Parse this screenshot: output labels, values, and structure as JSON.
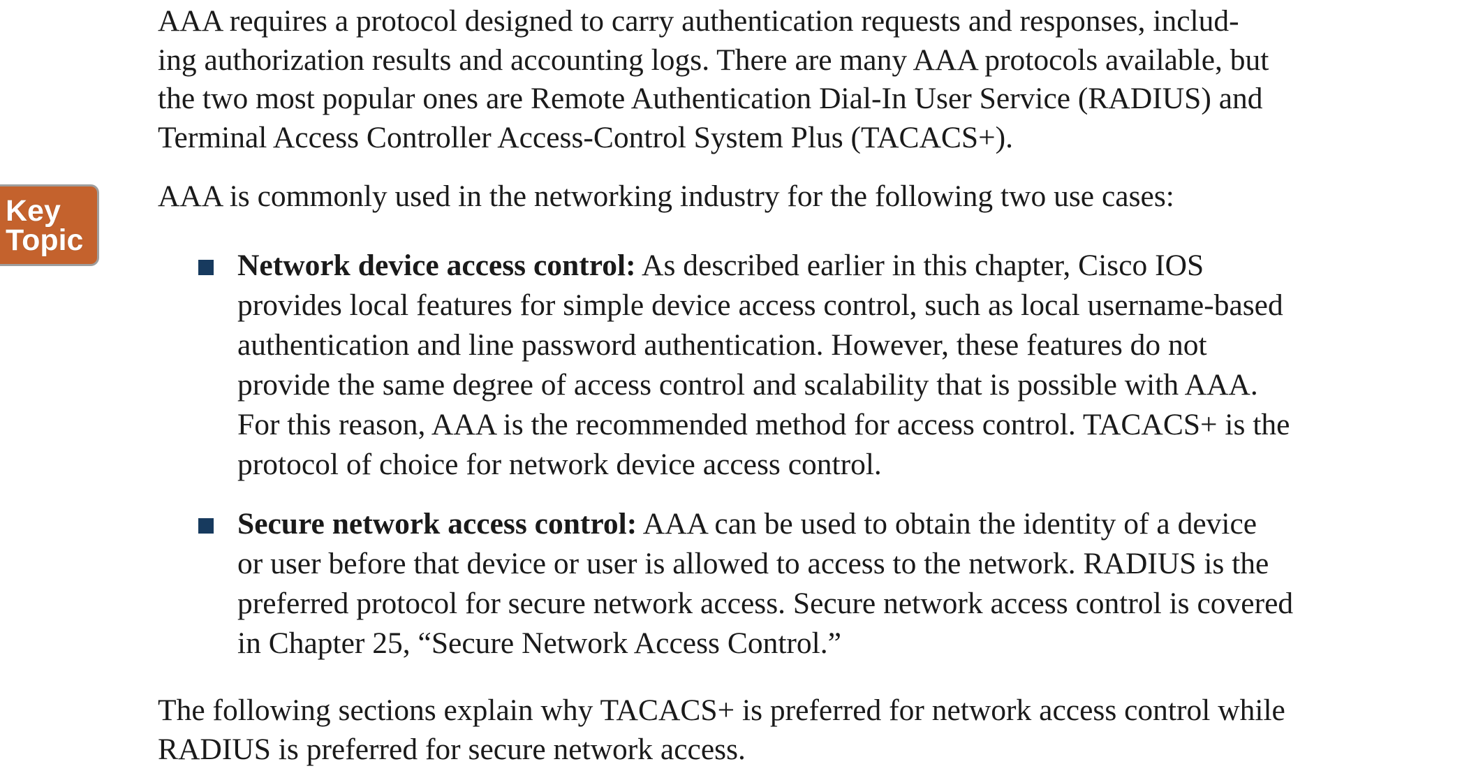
{
  "key_topic": {
    "line1": "Key",
    "line2": "Topic",
    "color": "#c4622d"
  },
  "intro": {
    "lines": [
      "AAA requires a protocol designed to carry authentication requests and responses, includ-",
      "ing authorization results and accounting logs. There are many AAA protocols available, but",
      "the two most popular ones are Remote Authentication Dial-In User Service (RADIUS) and",
      "Terminal Access Controller Access-Control System Plus (TACACS+)."
    ]
  },
  "use_cases_intro": "AAA is commonly used in the networking industry for the following two use cases:",
  "bullets": [
    {
      "term": "Network device access control:",
      "first_line": " As described earlier in this chapter, Cisco IOS",
      "lines": [
        "provides local features for simple device access control, such as local username-based",
        "authentication and line password authentication. However, these features do not",
        "provide the same degree of access control and scalability that is possible with AAA.",
        "For this reason, AAA is the recommended method for access control. TACACS+ is the",
        "protocol of choice for network device access control."
      ]
    },
    {
      "term": "Secure network access control:",
      "first_line": " AAA can be used to obtain the identity of a device",
      "lines": [
        "or user before that device or user is allowed to access to the network. RADIUS is the",
        "preferred protocol for secure network access. Secure network access control is covered",
        "in Chapter 25, “Secure Network Access Control.”"
      ]
    }
  ],
  "closing": {
    "lines": [
      "The following sections explain why TACACS+ is preferred for network access control while",
      "RADIUS is preferred for secure network access."
    ]
  },
  "bullet_color": "#173a5e"
}
